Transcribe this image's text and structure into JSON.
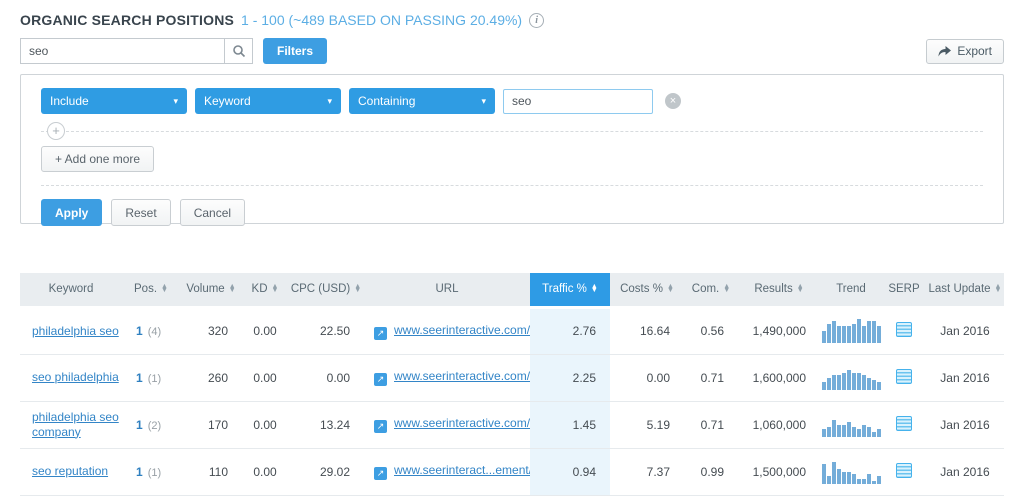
{
  "header": {
    "title": "ORGANIC SEARCH POSITIONS",
    "range_text": "1 - 100 (~489 BASED ON PASSING 20.49%)"
  },
  "icons": {
    "info": "i",
    "chevron_down": "▾",
    "close": "×",
    "plus": "+",
    "external_link": "↗",
    "sort_up": "▲",
    "sort_down": "▼"
  },
  "toolbar": {
    "search_value": "seo",
    "filters_label": "Filters",
    "export_label": "Export"
  },
  "filter_panel": {
    "dropdowns": [
      {
        "value": "Include"
      },
      {
        "value": "Keyword"
      },
      {
        "value": "Containing"
      }
    ],
    "value_input": "seo",
    "add_button": "+ Add one more",
    "apply_button": "Apply",
    "reset_button": "Reset",
    "cancel_button": "Cancel"
  },
  "table": {
    "columns": [
      {
        "label": "Keyword",
        "sortable": false,
        "active": false
      },
      {
        "label": "Pos.",
        "sortable": true,
        "active": false
      },
      {
        "label": "Volume",
        "sortable": true,
        "active": false
      },
      {
        "label": "KD",
        "sortable": true,
        "active": false
      },
      {
        "label": "CPC (USD)",
        "sortable": true,
        "active": false
      },
      {
        "label": "URL",
        "sortable": false,
        "active": false
      },
      {
        "label": "Traffic %",
        "sortable": true,
        "active": true
      },
      {
        "label": "Costs %",
        "sortable": true,
        "active": false
      },
      {
        "label": "Com.",
        "sortable": true,
        "active": false
      },
      {
        "label": "Results",
        "sortable": true,
        "active": false
      },
      {
        "label": "Trend",
        "sortable": false,
        "active": false
      },
      {
        "label": "SERP",
        "sortable": false,
        "active": false
      },
      {
        "label": "Last Update",
        "sortable": true,
        "active": false
      }
    ],
    "rows": [
      {
        "keyword": "philadelphia seo",
        "position": "1",
        "position_prev": "(4)",
        "volume": "320",
        "kd": "0.00",
        "cpc": "22.50",
        "url": "www.seerinteractive.com/",
        "traffic_pct": "2.76",
        "costs_pct": "16.64",
        "com": "0.56",
        "results": "1,490,000",
        "trend": [
          5,
          8,
          9,
          7,
          7,
          7,
          8,
          10,
          7,
          9,
          9,
          7
        ],
        "last_update": "Jan 2016"
      },
      {
        "keyword": "seo philadelphia",
        "position": "1",
        "position_prev": "(1)",
        "volume": "260",
        "kd": "0.00",
        "cpc": "0.00",
        "url": "www.seerinteractive.com/",
        "traffic_pct": "2.25",
        "costs_pct": "0.00",
        "com": "0.71",
        "results": "1,600,000",
        "trend": [
          3,
          5,
          6,
          6,
          7,
          8,
          7,
          7,
          6,
          5,
          4,
          3
        ],
        "last_update": "Jan 2016"
      },
      {
        "keyword": "philadelphia seo company",
        "position": "1",
        "position_prev": "(2)",
        "volume": "170",
        "kd": "0.00",
        "cpc": "13.24",
        "url": "www.seerinteractive.com/",
        "traffic_pct": "1.45",
        "costs_pct": "5.19",
        "com": "0.71",
        "results": "1,060,000",
        "trend": [
          3,
          4,
          7,
          5,
          5,
          6,
          4,
          3,
          5,
          4,
          2,
          3
        ],
        "last_update": "Jan 2016"
      },
      {
        "keyword": "seo reputation",
        "position": "1",
        "position_prev": "(1)",
        "volume": "110",
        "kd": "0.00",
        "cpc": "29.02",
        "url": "www.seerinteract...ement/",
        "traffic_pct": "0.94",
        "costs_pct": "7.37",
        "com": "0.99",
        "results": "1,500,000",
        "trend": [
          8,
          3,
          9,
          6,
          5,
          5,
          4,
          2,
          2,
          4,
          1,
          3
        ],
        "last_update": "Jan 2016"
      }
    ]
  },
  "colors": {
    "accent_blue": "#2e9be5",
    "link_blue": "#3385c7",
    "traffic_column_bg": "#eaf5fc",
    "header_bg": "#e9edf0"
  }
}
